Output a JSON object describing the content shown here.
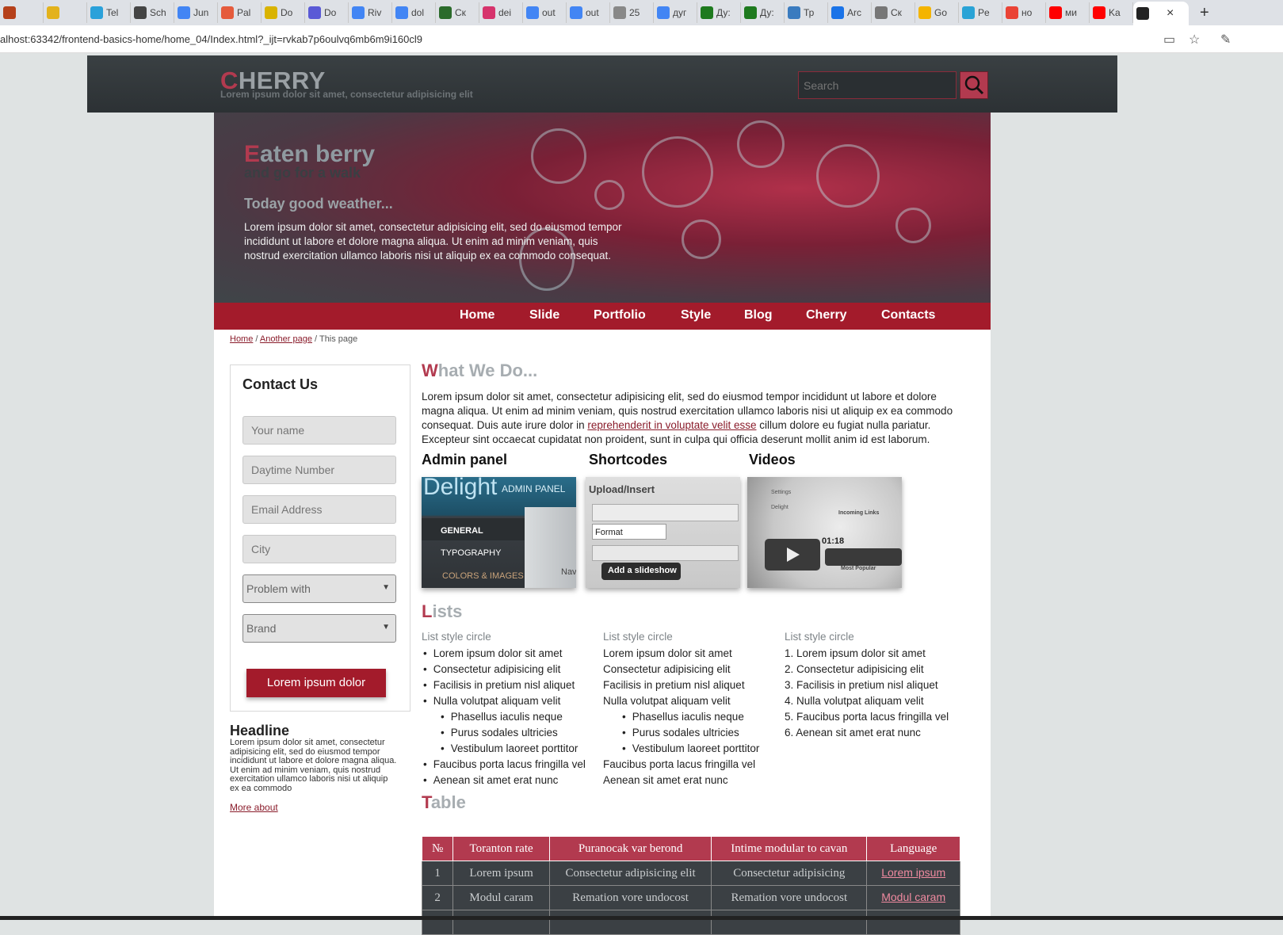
{
  "browser": {
    "tabs": [
      {
        "label": "",
        "color": "#b5401a"
      },
      {
        "label": "",
        "color": "#e3b21c"
      },
      {
        "label": "Tel",
        "color": "#2aa1da"
      },
      {
        "label": "Sch",
        "color": "#444444"
      },
      {
        "label": "Jun",
        "color": "#4285f4"
      },
      {
        "label": "Pal",
        "color": "#e55b3c"
      },
      {
        "label": "Do",
        "color": "#d9b300"
      },
      {
        "label": "Do",
        "color": "#5a5ad6"
      },
      {
        "label": "Riv",
        "color": "#4285f4"
      },
      {
        "label": "dol",
        "color": "#4285f4"
      },
      {
        "label": "Ск",
        "color": "#2b6b2b"
      },
      {
        "label": "dei",
        "color": "#d6336c"
      },
      {
        "label": "out",
        "color": "#4285f4"
      },
      {
        "label": "out",
        "color": "#4285f4"
      },
      {
        "label": "25",
        "color": "#888888"
      },
      {
        "label": "дуг",
        "color": "#4285f4"
      },
      {
        "label": "Ду:",
        "color": "#1e7a1e"
      },
      {
        "label": "Ду:",
        "color": "#1e7a1e"
      },
      {
        "label": "Тр",
        "color": "#3a7bbf"
      },
      {
        "label": "Arc",
        "color": "#1a73e8"
      },
      {
        "label": "Ск",
        "color": "#777777"
      },
      {
        "label": "Go",
        "color": "#f4b400"
      },
      {
        "label": "Pe",
        "color": "#29a3d6"
      },
      {
        "label": "но",
        "color": "#ea4335"
      },
      {
        "label": "ми",
        "color": "#ff0000"
      },
      {
        "label": "Ka",
        "color": "#ff0000"
      },
      {
        "label": "",
        "color": "#222222"
      }
    ],
    "url": "alhost:63342/frontend-basics-home/home_04/Index.html?_ijt=rvkab7p6oulvq6mb6m9i160cl9"
  },
  "header": {
    "logo_first": "C",
    "logo_rest": "HERRY",
    "slogan": "Lorem ipsum dolor sit amet, consectetur adipisicing elit",
    "search_placeholder": "Search"
  },
  "hero": {
    "title_first": "E",
    "title_rest": "aten berry",
    "subtitle": "and go for a walk",
    "heading": "Today good weather...",
    "text": "Lorem ipsum dolor sit amet, consectetur adipisicing elit, sed do eiusmod tempor incididunt ut labore et dolore magna aliqua. Ut enim ad minim veniam, quis nostrud exercitation ullamco laboris nisi ut aliquip ex ea commodo consequat."
  },
  "nav": [
    "Home",
    "Slide",
    "Portfolio",
    "Style",
    "Blog",
    "Cherry",
    "Contacts"
  ],
  "breadcrumb": {
    "home": "Home",
    "another": "Another page",
    "current": "This page",
    "sep": "/"
  },
  "contact": {
    "title": "Contact Us",
    "fields": [
      "Your name",
      "Daytime Number",
      "Email Address",
      "City"
    ],
    "selects": [
      "Problem with",
      "Brand"
    ],
    "submit": "Lorem ipsum dolor"
  },
  "sidebar": {
    "headline": "Headline",
    "text": "Lorem ipsum dolor sit amet, consectetur adipisicing elit, sed do eiusmod tempor incididunt ut labore et dolore magna aliqua. Ut enim ad minim veniam, quis nostrud exercitation ullamco laboris nisi ut aliquip ex ea commodo",
    "link": "More about"
  },
  "what": {
    "title_first": "W",
    "title_rest": "hat We Do...",
    "text_before": "Lorem ipsum dolor sit amet, consectetur adipisicing elit, sed do eiusmod tempor incididunt ut labore et dolore magna aliqua. Ut enim ad minim veniam, quis nostrud exercitation ullamco laboris nisi ut aliquip ex ea commodo consequat. Duis aute irure dolor in ",
    "link": "reprehenderit in voluptate velit esse",
    "text_after": " cillum dolore eu fugiat nulla pariatur. Excepteur sint occaecat cupidatat non proident, sunt in culpa qui officia deserunt mollit anim id est laborum."
  },
  "features": [
    {
      "title": "Admin panel",
      "thumb": {
        "brand": "Delight",
        "badge": "ADMIN PANEL",
        "items": [
          "GENERAL",
          "TYPOGRAPHY",
          "COLORS & IMAGES"
        ],
        "side": "Nav"
      }
    },
    {
      "title": "Shortcodes",
      "thumb": {
        "header": "Upload/Insert",
        "format": "Format",
        "tooltip": "Add a slideshow"
      }
    },
    {
      "title": "Videos",
      "thumb": {
        "time": "01:18",
        "items": [
          "Settings",
          "Delight",
          "Incoming Links",
          "Most Popular"
        ]
      }
    }
  ],
  "lists": {
    "title_first": "L",
    "title_rest": "ists",
    "columns": [
      {
        "heading": "List style circle",
        "style": "bullet",
        "items": [
          "Lorem ipsum dolor sit amet",
          "Consectetur adipisicing elit",
          "Facilisis in pretium nisl aliquet",
          "Nulla volutpat aliquam velit"
        ],
        "sub": [
          "Phasellus iaculis neque",
          "Purus sodales ultricies",
          "Vestibulum laoreet porttitor"
        ],
        "after": [
          "Faucibus porta lacus fringilla vel",
          "Aenean sit amet erat nunc"
        ]
      },
      {
        "heading": "List style circle",
        "style": "none",
        "items": [
          "Lorem ipsum dolor sit amet",
          "Consectetur adipisicing elit",
          "Facilisis in pretium nisl aliquet",
          "Nulla volutpat aliquam velit"
        ],
        "sub": [
          "Phasellus iaculis neque",
          "Purus sodales ultricies",
          "Vestibulum laoreet porttitor"
        ],
        "after": [
          "Faucibus porta lacus fringilla vel",
          "Aenean sit amet erat nunc"
        ]
      },
      {
        "heading": "List style circle",
        "style": "numbered",
        "items": [
          "Lorem ipsum dolor sit amet",
          "Consectetur adipisicing elit",
          "Facilisis in pretium nisl aliquet",
          "Nulla volutpat aliquam velit",
          "Faucibus porta lacus fringilla vel",
          "Aenean sit amet erat nunc"
        ],
        "sub": [],
        "after": []
      }
    ]
  },
  "table": {
    "title_first": "T",
    "title_rest": "able",
    "headers": [
      "№",
      "Toranton rate",
      "Puranocak var berond",
      "Intime modular to cavan",
      "Language"
    ],
    "rows": [
      [
        "1",
        "Lorem ipsum",
        "Consectetur adipisicing elit",
        "Consectetur adipisicing",
        "Lorem ipsum"
      ],
      [
        "2",
        "Modul caram",
        "Remation vore undocost",
        "Remation vore undocost",
        "Modul caram"
      ]
    ]
  },
  "colors": {
    "accent": "#a31b2b",
    "brand": "#b23a4f",
    "header_bg": "#2f3437",
    "page_bg": "#dfe3e3"
  }
}
